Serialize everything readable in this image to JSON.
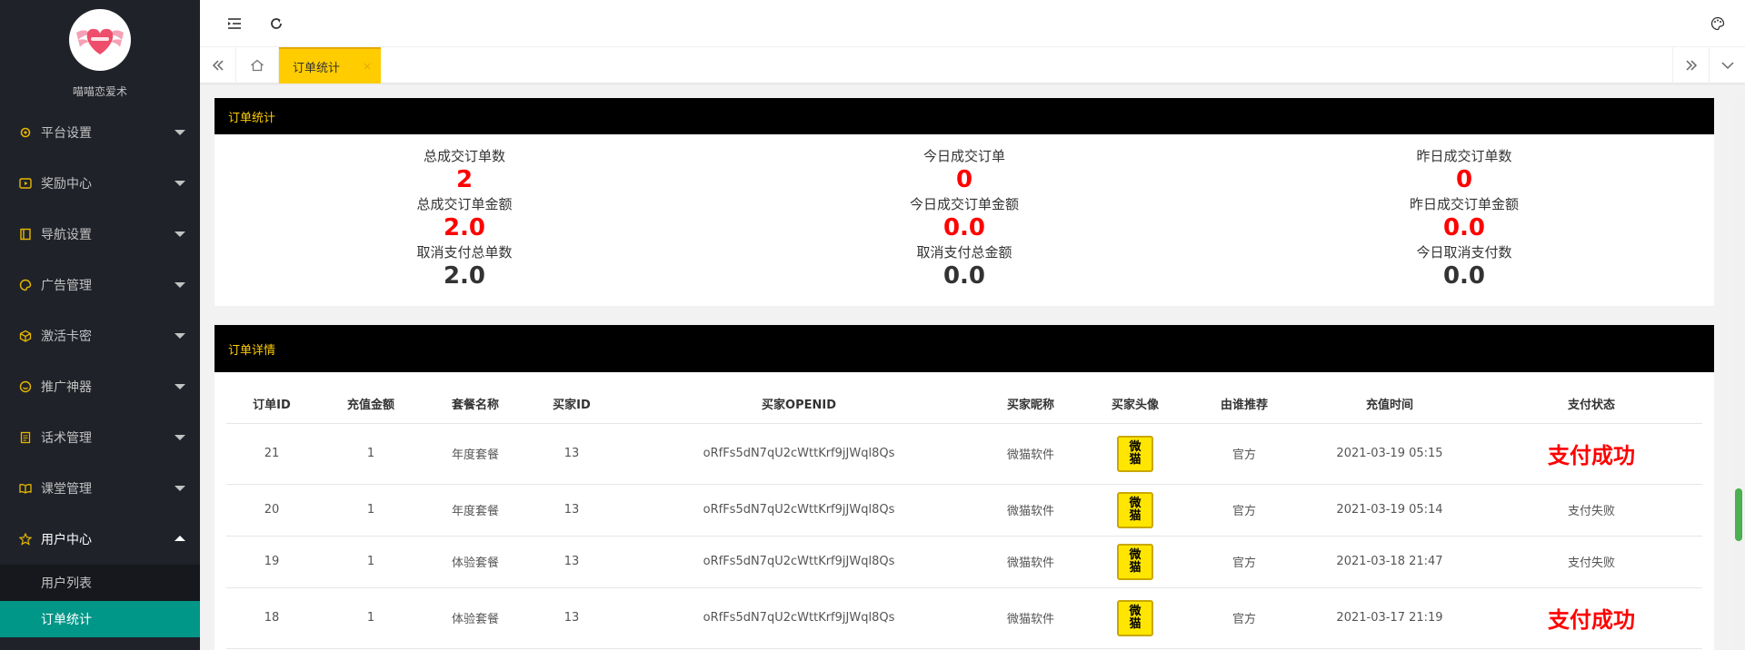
{
  "brand": {
    "name": "喵喵恋爱术"
  },
  "sidebar": {
    "items": [
      {
        "label": "平台设置",
        "icon": "gear-icon"
      },
      {
        "label": "奖励中心",
        "icon": "play-icon"
      },
      {
        "label": "导航设置",
        "icon": "book-icon"
      },
      {
        "label": "广告管理",
        "icon": "palette-icon"
      },
      {
        "label": "激活卡密",
        "icon": "cube-icon"
      },
      {
        "label": "推广神器",
        "icon": "smile-icon"
      },
      {
        "label": "话术管理",
        "icon": "doc-icon"
      },
      {
        "label": "课堂管理",
        "icon": "reader-icon"
      },
      {
        "label": "用户中心",
        "icon": "star-icon"
      }
    ],
    "sub_items": [
      {
        "label": "用户列表"
      },
      {
        "label": "订单统计"
      }
    ]
  },
  "tabs": {
    "active_label": "订单统计",
    "close": "×"
  },
  "stats_card": {
    "title": "订单统计",
    "columns": [
      {
        "rows": [
          {
            "label": "总成交订单数",
            "value": "2"
          },
          {
            "label": "总成交订单金额",
            "value": "2.0"
          },
          {
            "label": "取消支付总单数",
            "value": "2.0"
          }
        ]
      },
      {
        "rows": [
          {
            "label": "今日成交订单",
            "value": "0"
          },
          {
            "label": "今日成交订单金额",
            "value": "0.0"
          },
          {
            "label": "取消支付总金额",
            "value": "0.0"
          }
        ]
      },
      {
        "rows": [
          {
            "label": "昨日成交订单数",
            "value": "0"
          },
          {
            "label": "昨日成交订单金额",
            "value": "0.0"
          },
          {
            "label": "今日取消支付数",
            "value": "0.0"
          }
        ]
      }
    ]
  },
  "orders_card": {
    "title": "订单详情",
    "headers": [
      "订单ID",
      "充值金额",
      "套餐名称",
      "买家ID",
      "买家OPENID",
      "买家昵称",
      "买家头像",
      "由谁推荐",
      "充值时间",
      "支付状态"
    ],
    "avatar_text": "微猫",
    "rows": [
      {
        "id": "21",
        "amount": "1",
        "package": "年度套餐",
        "buyer_id": "13",
        "openid": "oRfFs5dN7qU2cWttKrf9jJWql8Qs",
        "nickname": "微猫软件",
        "referrer": "官方",
        "time": "2021-03-19 05:15",
        "status": "支付成功",
        "ok": true
      },
      {
        "id": "20",
        "amount": "1",
        "package": "年度套餐",
        "buyer_id": "13",
        "openid": "oRfFs5dN7qU2cWttKrf9jJWql8Qs",
        "nickname": "微猫软件",
        "referrer": "官方",
        "time": "2021-03-19 05:14",
        "status": "支付失败",
        "ok": false
      },
      {
        "id": "19",
        "amount": "1",
        "package": "体验套餐",
        "buyer_id": "13",
        "openid": "oRfFs5dN7qU2cWttKrf9jJWql8Qs",
        "nickname": "微猫软件",
        "referrer": "官方",
        "time": "2021-03-18 21:47",
        "status": "支付失败",
        "ok": false
      },
      {
        "id": "18",
        "amount": "1",
        "package": "体验套餐",
        "buyer_id": "13",
        "openid": "oRfFs5dN7qU2cWttKrf9jJWql8Qs",
        "nickname": "微猫软件",
        "referrer": "官方",
        "time": "2021-03-17 21:19",
        "status": "支付成功",
        "ok": true
      }
    ]
  },
  "colors": {
    "sidebar_bg": "#20222a",
    "accent_teal": "#009688",
    "tab_yellow": "#ffcc00",
    "status_red": "#ff0000"
  }
}
